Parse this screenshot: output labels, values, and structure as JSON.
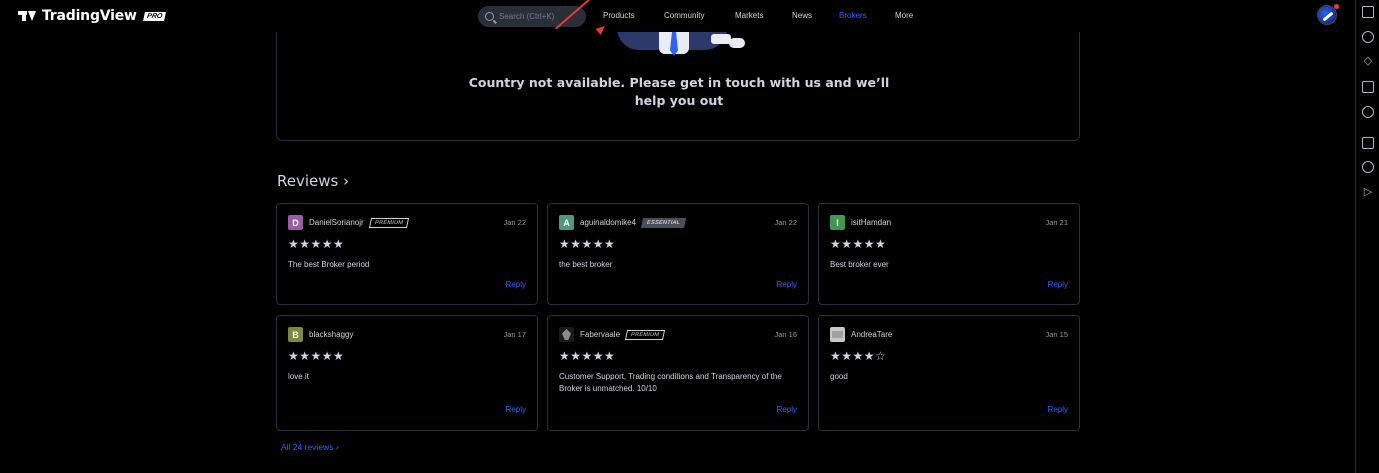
{
  "header": {
    "logo_text": "TradingView",
    "logo_badge": "PRO",
    "search_placeholder": "Search (Ctrl+K)",
    "nav": [
      {
        "label": "Products",
        "active": false
      },
      {
        "label": "Community",
        "active": false
      },
      {
        "label": "Markets",
        "active": false
      },
      {
        "label": "News",
        "active": false
      },
      {
        "label": "Brokers",
        "active": true
      },
      {
        "label": "More",
        "active": false
      }
    ],
    "accent_color": "#2962ff"
  },
  "right_sidebar": {
    "icons": [
      "watchlist-icon",
      "alarm-clock-icon",
      "hotlist-icon",
      "calendar-icon",
      "ideas-bulb-icon",
      "chat-icon",
      "broadcast-icon",
      "playback-icon"
    ]
  },
  "notice": {
    "line1": "Country not available. Please get in touch with us and we’ll",
    "line2": "help you out"
  },
  "reviews": {
    "title": "Reviews ›",
    "all_link": "All 24 reviews ›",
    "reply_label": "Reply",
    "items": [
      {
        "avatar_letter": "D",
        "avatar_color": "#9c5aa8",
        "username": "DanielSorianojr",
        "badge": "PREMIUM",
        "date": "Jan 22",
        "stars": "★★★★★",
        "text": "The best Broker period"
      },
      {
        "avatar_letter": "A",
        "avatar_color": "#4c9a78",
        "username": "aguinaldomike4",
        "badge": "ESSENTIAL",
        "date": "Jan 22",
        "stars": "★★★★★",
        "text": "the best broker"
      },
      {
        "avatar_letter": "I",
        "avatar_color": "#3d9a4f",
        "username": "isitHamdan",
        "badge": "",
        "date": "Jan 21",
        "stars": "★★★★★",
        "text": "Best broker ever"
      },
      {
        "avatar_letter": "B",
        "avatar_color": "#7a8a3e",
        "username": "blackshaggy",
        "badge": "",
        "date": "Jan 17",
        "stars": "★★★★★",
        "text": "love it"
      },
      {
        "avatar_letter": "",
        "avatar_color": "",
        "username": "Fabervaale",
        "badge": "PREMIUM",
        "date": "Jan 16",
        "stars": "★★★★★",
        "text": "Customer Support, Trading conditions and Transparency of the Broker is unmatched. 10/10"
      },
      {
        "avatar_letter": "",
        "avatar_color": "",
        "username": "AndreaTare",
        "badge": "",
        "date": "Jan 15",
        "stars": "★★★★☆",
        "text": "good"
      }
    ]
  }
}
